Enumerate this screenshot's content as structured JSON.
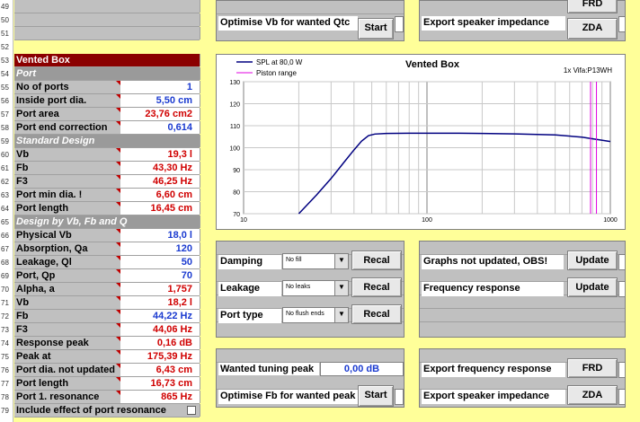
{
  "row_numbers": [
    "49",
    "50",
    "51",
    "52",
    "53",
    "54",
    "55",
    "56",
    "57",
    "58",
    "59",
    "60",
    "61",
    "62",
    "63",
    "64",
    "65",
    "66",
    "67",
    "68",
    "69",
    "70",
    "71",
    "72",
    "73",
    "74",
    "75",
    "76",
    "77",
    "78",
    "79"
  ],
  "left_panel": {
    "title": "Vented Box",
    "port_header": "Port",
    "rows_port": [
      {
        "label": "No of ports",
        "value": "1",
        "color": "blue"
      },
      {
        "label": "Inside port dia.",
        "value": "5,50 cm",
        "color": "blue"
      },
      {
        "label": "Port area",
        "value": "23,76 cm2",
        "color": "red"
      },
      {
        "label": "Port end correction",
        "value": "0,614",
        "color": "blue"
      }
    ],
    "standard_header": "Standard Design",
    "rows_standard": [
      {
        "label": "Vb",
        "value": "19,3 l",
        "color": "red"
      },
      {
        "label": "Fb",
        "value": "43,30 Hz",
        "color": "red"
      },
      {
        "label": "F3",
        "value": "46,25 Hz",
        "color": "red"
      },
      {
        "label": "Port min dia. !",
        "value": "6,60 cm",
        "color": "red"
      },
      {
        "label": "Port length",
        "value": "16,45 cm",
        "color": "red"
      }
    ],
    "design_header": "Design by Vb, Fb and Q",
    "rows_design": [
      {
        "label": "Physical Vb",
        "value": "18,0 l",
        "color": "blue"
      },
      {
        "label": "Absorption, Qa",
        "value": "120",
        "color": "blue"
      },
      {
        "label": "Leakage, Ql",
        "value": "50",
        "color": "blue"
      },
      {
        "label": "Port, Qp",
        "value": "70",
        "color": "blue"
      },
      {
        "label": "Alpha, a",
        "value": "1,757",
        "color": "red"
      },
      {
        "label": "Vb",
        "value": "18,2 l",
        "color": "red"
      },
      {
        "label": "Fb",
        "value": "44,22 Hz",
        "color": "blue"
      },
      {
        "label": "F3",
        "value": "44,06 Hz",
        "color": "red"
      },
      {
        "label": "Response peak",
        "value": "0,16 dB",
        "color": "red"
      },
      {
        "label": "Peak at",
        "value": "175,39 Hz",
        "color": "red"
      },
      {
        "label": "Port dia. not updated",
        "value": "6,43 cm",
        "color": "red"
      },
      {
        "label": "Port length",
        "value": "16,73 cm",
        "color": "red"
      },
      {
        "label": "Port 1. resonance",
        "value": "865 Hz",
        "color": "red"
      }
    ],
    "include_effect_label": "Include effect of port resonance"
  },
  "top_controls": {
    "optimise_vb_label": "Optimise Vb for wanted Qtc",
    "start_label": "Start",
    "export_impedance_label": "Export speaker impedance",
    "frd_label": "FRD",
    "zda_label": "ZDA"
  },
  "chart_data": {
    "type": "line",
    "title": "Vented Box",
    "subtitle": "1x Vifa:P13WH",
    "legend": [
      "SPL at 80,0 W",
      "Piston range"
    ],
    "x_scale": "log",
    "xlim": [
      10,
      1000
    ],
    "x_ticks": [
      "10",
      "100",
      "1000"
    ],
    "ylim": [
      70,
      130
    ],
    "y_ticks": [
      "70",
      "80",
      "90",
      "100",
      "110",
      "120",
      "130"
    ],
    "grid": true,
    "legend_position": "top-left",
    "series": [
      {
        "name": "SPL at 80,0 W",
        "color": "#000080",
        "x": [
          20,
          25,
          30,
          35,
          40,
          44,
          48,
          52,
          60,
          80,
          100,
          150,
          200,
          300,
          500,
          700,
          1000
        ],
        "y": [
          70,
          78.5,
          86,
          93,
          99,
          103,
          105.5,
          106.2,
          106.5,
          106.6,
          106.6,
          106.6,
          106.5,
          106.3,
          105.8,
          104.8,
          102.8
        ]
      },
      {
        "name": "Piston range",
        "color": "#e000e0",
        "x": [
          780,
          780
        ],
        "y": [
          70,
          130
        ]
      },
      {
        "name": "Piston range 2",
        "color": "#e000e0",
        "x": [
          840,
          840
        ],
        "y": [
          70,
          130
        ]
      }
    ]
  },
  "mid_controls": {
    "damping_label": "Damping",
    "damping_value": "No fill",
    "leakage_label": "Leakage",
    "leakage_value": "No leaks",
    "port_type_label": "Port type",
    "port_type_value": "No flush ends",
    "recal_label": "Recal",
    "graphs_not_updated_label": "Graphs not updated, OBS!",
    "frequency_response_label": "Frequency response",
    "update_label": "Update"
  },
  "bottom_controls": {
    "wanted_tuning_label": "Wanted tuning peak",
    "wanted_tuning_value": "0,00 dB",
    "optimise_fb_label": "Optimise Fb for wanted peak",
    "start_label": "Start",
    "export_frequency_label": "Export frequency response",
    "export_impedance_label": "Export speaker impedance",
    "frd_label": "FRD",
    "zda_label": "ZDA"
  }
}
